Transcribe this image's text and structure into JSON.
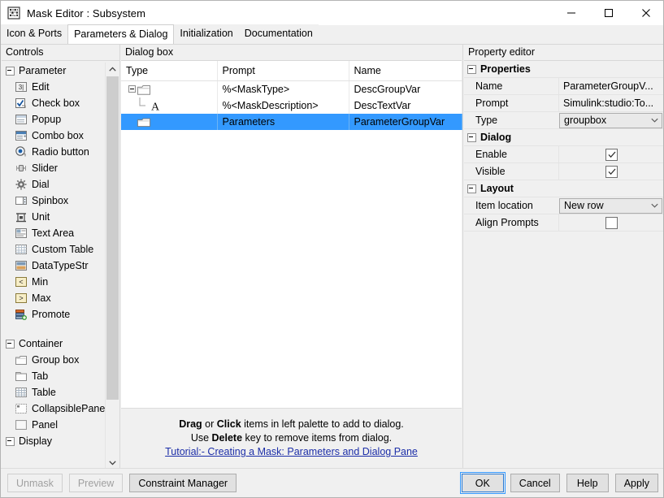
{
  "window": {
    "title": "Mask Editor : Subsystem",
    "icon": "matlab-mask-icon",
    "minimize": "—",
    "maximize": "□",
    "close": "✕"
  },
  "tabs": [
    {
      "label": "Icon & Ports",
      "active": false
    },
    {
      "label": "Parameters & Dialog",
      "active": true
    },
    {
      "label": "Initialization",
      "active": false
    },
    {
      "label": "Documentation",
      "active": false
    }
  ],
  "palette": {
    "title": "Controls",
    "groups": [
      {
        "label": "Parameter",
        "items": [
          {
            "label": "Edit",
            "icon": "edit-field-icon"
          },
          {
            "label": "Check box",
            "icon": "check-box-icon"
          },
          {
            "label": "Popup",
            "icon": "popup-icon"
          },
          {
            "label": "Combo box",
            "icon": "combo-box-icon"
          },
          {
            "label": "Radio button",
            "icon": "radio-button-icon"
          },
          {
            "label": "Slider",
            "icon": "slider-icon"
          },
          {
            "label": "Dial",
            "icon": "dial-icon"
          },
          {
            "label": "Spinbox",
            "icon": "spinbox-icon"
          },
          {
            "label": "Unit",
            "icon": "unit-icon"
          },
          {
            "label": "Text Area",
            "icon": "text-area-icon"
          },
          {
            "label": "Custom Table",
            "icon": "custom-table-icon"
          },
          {
            "label": "DataTypeStr",
            "icon": "datatypestr-icon"
          },
          {
            "label": "Min",
            "icon": "min-icon"
          },
          {
            "label": "Max",
            "icon": "max-icon"
          },
          {
            "label": "Promote",
            "icon": "promote-icon"
          }
        ]
      },
      {
        "label": "Container",
        "items": [
          {
            "label": "Group box",
            "icon": "group-box-icon"
          },
          {
            "label": "Tab",
            "icon": "tab-icon"
          },
          {
            "label": "Table",
            "icon": "table-icon"
          },
          {
            "label": "CollapsiblePane",
            "icon": "collapsible-pane-icon"
          },
          {
            "label": "Panel",
            "icon": "panel-icon"
          }
        ]
      },
      {
        "label": "Display",
        "items": []
      }
    ],
    "scroll_up": "⌃",
    "scroll_down": "⌄"
  },
  "dialog_box": {
    "title": "Dialog box",
    "columns": [
      "Type",
      "Prompt",
      "Name"
    ],
    "rows": [
      {
        "type_icon": "group-box-icon",
        "indent": 0,
        "expander": "collapse",
        "prompt": "%<MaskType>",
        "name": "DescGroupVar",
        "selected": false
      },
      {
        "type_icon": "text-A-icon",
        "indent": 1,
        "expander": "none",
        "prompt": "%<MaskDescription>",
        "name": "DescTextVar",
        "selected": false
      },
      {
        "type_icon": "group-box-icon",
        "indent": 0,
        "expander": "none",
        "prompt": "Parameters",
        "name": "ParameterGroupVar",
        "selected": true
      }
    ],
    "hint": {
      "line1_bold_1": "Drag",
      "line1_mid": " or ",
      "line1_bold_2": "Click",
      "line1_rest": " items in left palette to add to dialog.",
      "line2_pre": "Use ",
      "line2_bold": "Delete",
      "line2_rest": " key to remove items from dialog.",
      "link": "Tutorial:- Creating a Mask: Parameters and Dialog Pane"
    }
  },
  "property_editor": {
    "title": "Property editor",
    "sections": [
      {
        "label": "Properties",
        "rows": [
          {
            "label": "Name",
            "value": "ParameterGroupV...",
            "kind": "text"
          },
          {
            "label": "Prompt",
            "value": "Simulink:studio:To...",
            "kind": "text"
          },
          {
            "label": "Type",
            "value": "groupbox",
            "kind": "combo"
          }
        ]
      },
      {
        "label": "Dialog",
        "rows": [
          {
            "label": "Enable",
            "value": "✓",
            "kind": "checkbox",
            "checked": true
          },
          {
            "label": "Visible",
            "value": "✓",
            "kind": "checkbox",
            "checked": true
          }
        ]
      },
      {
        "label": "Layout",
        "rows": [
          {
            "label": "Item location",
            "value": "New row",
            "kind": "combo"
          },
          {
            "label": "Align Prompts",
            "value": "",
            "kind": "checkbox",
            "checked": false
          }
        ]
      }
    ],
    "combo_arrow": "⌄"
  },
  "footer": {
    "left_buttons": [
      {
        "label": "Unmask",
        "disabled": true
      },
      {
        "label": "Preview",
        "disabled": true
      },
      {
        "label": "Constraint Manager",
        "disabled": false
      }
    ],
    "right_buttons": [
      {
        "label": "OK",
        "focused": true
      },
      {
        "label": "Cancel",
        "focused": false
      },
      {
        "label": "Help",
        "focused": false
      },
      {
        "label": "Apply",
        "focused": false
      }
    ]
  },
  "colors": {
    "selection_blue": "#3399ff",
    "link_blue": "#1c2ea8",
    "chrome_gray": "#f0f0f0"
  }
}
